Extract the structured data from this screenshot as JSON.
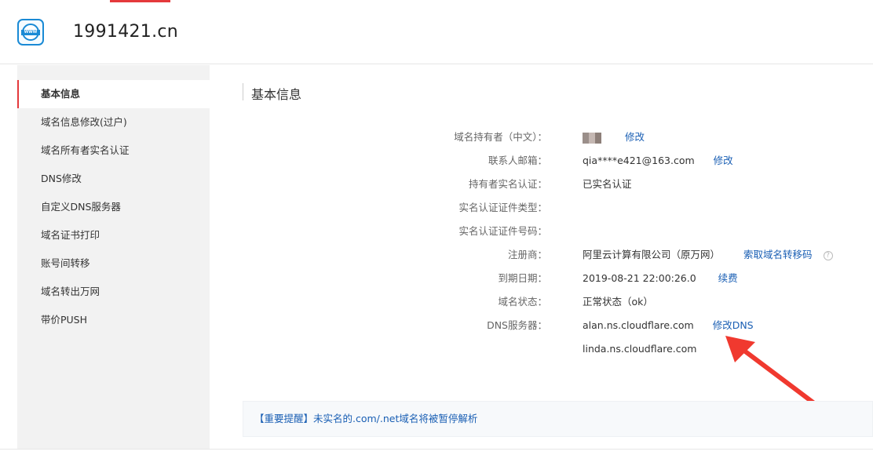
{
  "header": {
    "domain": "1991421.cn",
    "logo_text": "WWW"
  },
  "sidebar": {
    "items": [
      {
        "label": "基本信息",
        "active": true
      },
      {
        "label": "域名信息修改(过户)"
      },
      {
        "label": "域名所有者实名认证"
      },
      {
        "label": "DNS修改"
      },
      {
        "label": "自定义DNS服务器"
      },
      {
        "label": "域名证书打印"
      },
      {
        "label": "账号间转移"
      },
      {
        "label": "域名转出万网"
      },
      {
        "label": "带价PUSH"
      }
    ]
  },
  "main": {
    "title": "基本信息",
    "rows": [
      {
        "label": "域名持有者（中文）：",
        "value": "",
        "link": "修改"
      },
      {
        "label": "联系人邮箱：",
        "value": "qia****e421@163.com",
        "link": "修改"
      },
      {
        "label": "持有者实名认证：",
        "value": "已实名认证"
      },
      {
        "label": "实名认证证件类型：",
        "value": ""
      },
      {
        "label": "实名认证证件号码：",
        "value": ""
      },
      {
        "label": "注册商：",
        "value": "阿里云计算有限公司（原万网）",
        "link": "索取域名转移码",
        "help": "?"
      },
      {
        "label": "到期日期：",
        "value": "2019-08-21 22:00:26.0",
        "link": "续费"
      },
      {
        "label": "域名状态：",
        "value": "正常状态（ok）"
      },
      {
        "label": "DNS服务器：",
        "value": "alan.ns.cloudflare.com",
        "link": "修改DNS"
      },
      {
        "label": "",
        "value": "linda.ns.cloudflare.com"
      }
    ],
    "notice": "【重要提醒】未实名的.com/.net域名将被暂停解析"
  },
  "colors": {
    "accent": "#e4393c",
    "link": "#1a5fb4",
    "annotation_arrow": "#f0392f"
  },
  "icons": {
    "logo": "www-globe-icon",
    "help": "question-circle-icon",
    "annotation": "red-arrow-annotation"
  }
}
